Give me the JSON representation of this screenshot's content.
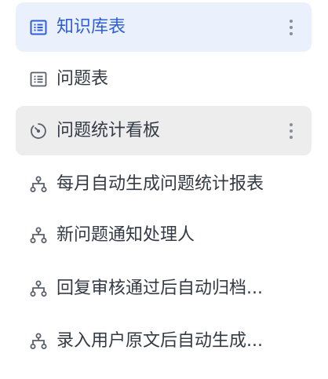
{
  "nav": {
    "items": [
      {
        "label": "知识库表",
        "icon": "table-list-icon",
        "state": "active"
      },
      {
        "label": "问题表",
        "icon": "table-list-icon",
        "state": "normal"
      },
      {
        "label": "问题统计看板",
        "icon": "dashboard-gauge-icon",
        "state": "hover"
      },
      {
        "label": "每月自动生成问题统计报表",
        "icon": "workflow-icon",
        "state": "normal"
      },
      {
        "label": "新问题通知处理人",
        "icon": "workflow-icon",
        "state": "normal"
      },
      {
        "label": "回复审核通过后自动归档...",
        "icon": "workflow-icon",
        "state": "normal"
      },
      {
        "label": "录入用户原文后自动生成...",
        "icon": "workflow-icon",
        "state": "normal"
      }
    ]
  },
  "colors": {
    "active_bg": "#ebf0fd",
    "active_fg": "#2f5fd7",
    "hover_bg": "#ededee",
    "text": "#333a44",
    "icon": "#5a606a"
  }
}
